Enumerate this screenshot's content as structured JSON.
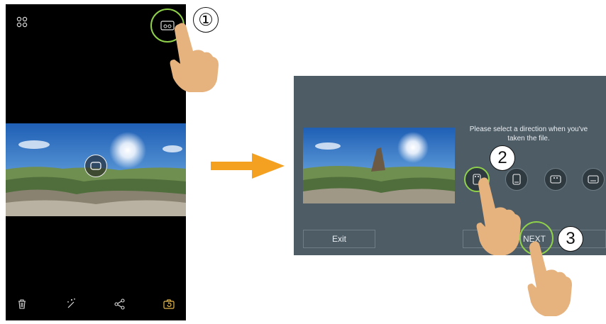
{
  "phone": {
    "bottom_toolbar": [
      "delete",
      "auto-enhance",
      "share",
      "rotate-camera"
    ]
  },
  "dialog": {
    "instruction": "Please select a direction when you've taken the file.",
    "exit_label": "Exit",
    "next_label": "NEXT",
    "directions": [
      "portrait-front",
      "portrait-side",
      "landscape-top",
      "landscape-bottom"
    ]
  },
  "steps": [
    "①",
    "2",
    "3"
  ],
  "colors": {
    "highlight_ring": "#8fd14a",
    "arrow": "#f4a020",
    "dialog_bg": "#4e5c66",
    "hand": "#e6b27e"
  }
}
